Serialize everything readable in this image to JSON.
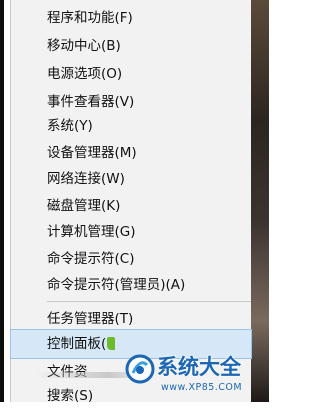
{
  "menu": {
    "items": [
      {
        "label": "程序和功能(F)"
      },
      {
        "label": "移动中心(B)"
      },
      {
        "label": "电源选项(O)"
      },
      {
        "label": "事件查看器(V)"
      },
      {
        "label": "系统(Y)"
      },
      {
        "label": "设备管理器(M)"
      },
      {
        "label": "网络连接(W)"
      },
      {
        "label": "磁盘管理(K)"
      },
      {
        "label": "计算机管理(G)"
      },
      {
        "label": "命令提示符(C)"
      },
      {
        "label": "命令提示符(管理员)(A)"
      },
      {
        "label": "任务管理器(T)"
      },
      {
        "label": "控制面板(",
        "selected": true
      },
      {
        "label": "文件资"
      },
      {
        "label": "搜索(S)"
      }
    ]
  },
  "watermark": {
    "title": "系统大全",
    "url": "www.XP85.COM",
    "color": "#1b66b5"
  },
  "colors": {
    "menu_bg": "#f2f2f2",
    "selected_bg": "#d6e8f7",
    "cursor": "#6dbb2a"
  }
}
